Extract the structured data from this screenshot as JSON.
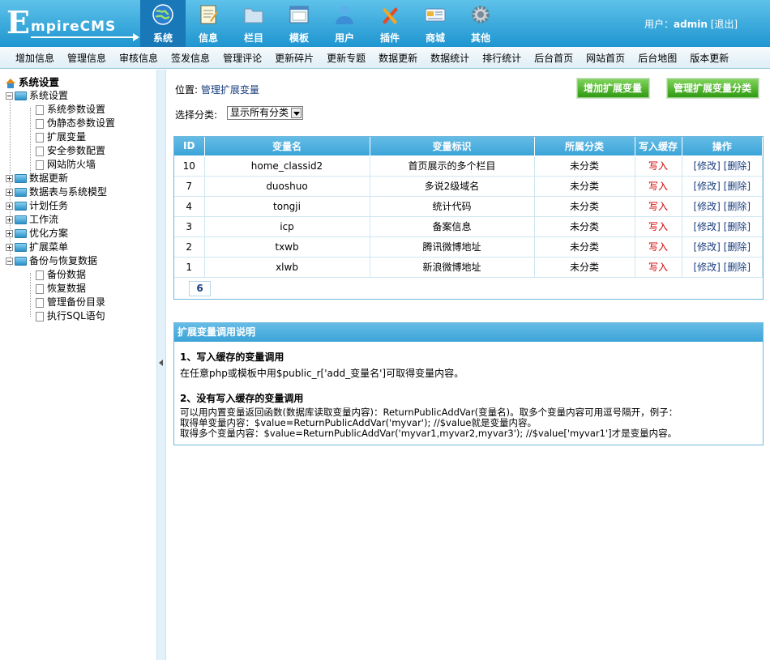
{
  "logo": {
    "big": "E",
    "text": "mpireCMS"
  },
  "main_nav": [
    {
      "label": "系统",
      "icon": "globe-icon",
      "active": true
    },
    {
      "label": "信息",
      "icon": "notepad-icon"
    },
    {
      "label": "栏目",
      "icon": "folder-icon"
    },
    {
      "label": "模板",
      "icon": "window-icon"
    },
    {
      "label": "用户",
      "icon": "user-icon"
    },
    {
      "label": "插件",
      "icon": "tools-icon"
    },
    {
      "label": "商城",
      "icon": "card-icon"
    },
    {
      "label": "其他",
      "icon": "gear-icon"
    }
  ],
  "user": {
    "label": "用户：",
    "name": "admin",
    "logout": "[退出]"
  },
  "sub_nav": [
    "增加信息",
    "管理信息",
    "审核信息",
    "签发信息",
    "管理评论",
    "更新碎片",
    "更新专题",
    "数据更新",
    "数据统计",
    "排行统计",
    "后台首页",
    "网站首页",
    "后台地图",
    "版本更新"
  ],
  "sidebar": {
    "root": "系统设置",
    "system": {
      "label": "系统设置",
      "children": [
        "系统参数设置",
        "伪静态参数设置",
        "扩展变量",
        "安全参数配置",
        "网站防火墙"
      ]
    },
    "collapsed": [
      "数据更新",
      "数据表与系统模型",
      "计划任务",
      "工作流",
      "优化方案",
      "扩展菜单"
    ],
    "backup": {
      "label": "备份与恢复数据",
      "children": [
        "备份数据",
        "恢复数据",
        "管理备份目录",
        "执行SQL语句"
      ]
    }
  },
  "location": {
    "label": "位置: ",
    "link": "管理扩展变量"
  },
  "buttons": {
    "add": "增加扩展变量",
    "manage": "管理扩展变量分类"
  },
  "filter": {
    "label": "选择分类:",
    "selected": "显示所有分类"
  },
  "table": {
    "headers": [
      "ID",
      "变量名",
      "变量标识",
      "所属分类",
      "写入缓存",
      "操作"
    ],
    "rows": [
      {
        "id": "10",
        "name": "home_classid2",
        "label": "首页展示的多个栏目",
        "category": "未分类",
        "cache": "写入",
        "edit": "[修改]",
        "del": "[删除]"
      },
      {
        "id": "7",
        "name": "duoshuo",
        "label": "多说2级域名",
        "category": "未分类",
        "cache": "写入",
        "edit": "[修改]",
        "del": "[删除]"
      },
      {
        "id": "4",
        "name": "tongji",
        "label": "统计代码",
        "category": "未分类",
        "cache": "写入",
        "edit": "[修改]",
        "del": "[删除]"
      },
      {
        "id": "3",
        "name": "icp",
        "label": "备案信息",
        "category": "未分类",
        "cache": "写入",
        "edit": "[修改]",
        "del": "[删除]"
      },
      {
        "id": "2",
        "name": "txwb",
        "label": "腾讯微博地址",
        "category": "未分类",
        "cache": "写入",
        "edit": "[修改]",
        "del": "[删除]"
      },
      {
        "id": "1",
        "name": "xlwb",
        "label": "新浪微博地址",
        "category": "未分类",
        "cache": "写入",
        "edit": "[修改]",
        "del": "[删除]"
      }
    ],
    "total": "6"
  },
  "help": {
    "title": "扩展变量调用说明",
    "t1": "1、写入缓存的变量调用",
    "p1": "在任意php或模板中用$public_r['add_变量名']可取得变量内容。",
    "t2": "2、没有写入缓存的变量调用",
    "p2a": "可以用内置变量返回函数(数据库读取变量内容)：ReturnPublicAddVar(变量名)。取多个变量内容可用逗号隔开，例子：",
    "p2b": "取得单变量内容：$value=ReturnPublicAddVar('myvar'); //$value就是变量内容。",
    "p2c": "取得多个变量内容：$value=ReturnPublicAddVar('myvar1,myvar2,myvar3'); //$value['myvar1']才是变量内容。"
  }
}
